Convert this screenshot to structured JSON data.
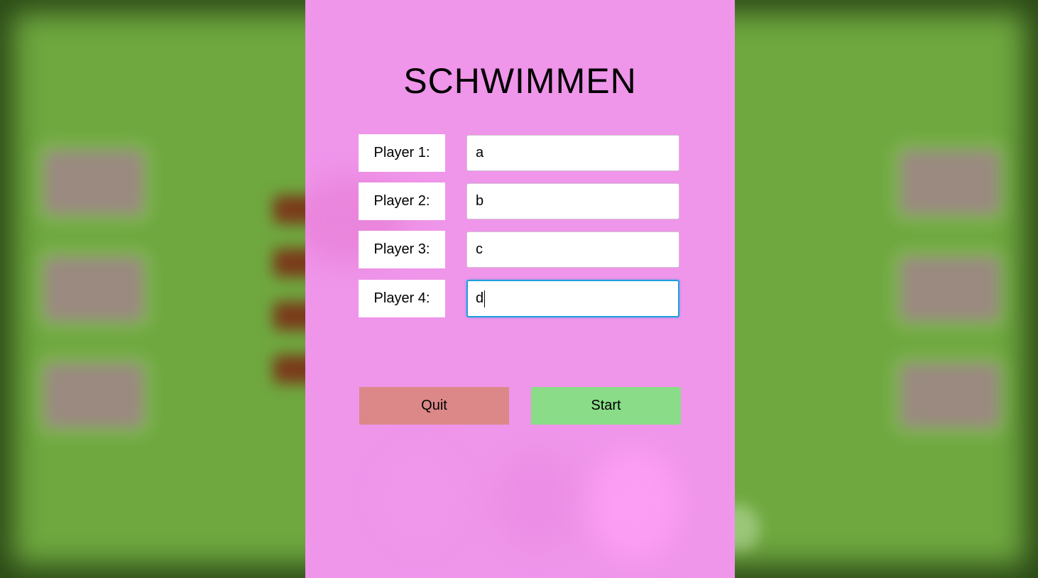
{
  "title": "SCHWIMMEN",
  "players": [
    {
      "label": "Player 1:",
      "value": "a"
    },
    {
      "label": "Player 2:",
      "value": "b"
    },
    {
      "label": "Player 3:",
      "value": "c"
    },
    {
      "label": "Player 4:",
      "value": "d"
    }
  ],
  "buttons": {
    "quit_label": "Quit",
    "start_label": "Start"
  },
  "colors": {
    "panel": "#ef95ea",
    "background": "#6fa83f",
    "quit": "#dc8888",
    "start": "#8adc88",
    "focus": "#1f9ee0"
  }
}
